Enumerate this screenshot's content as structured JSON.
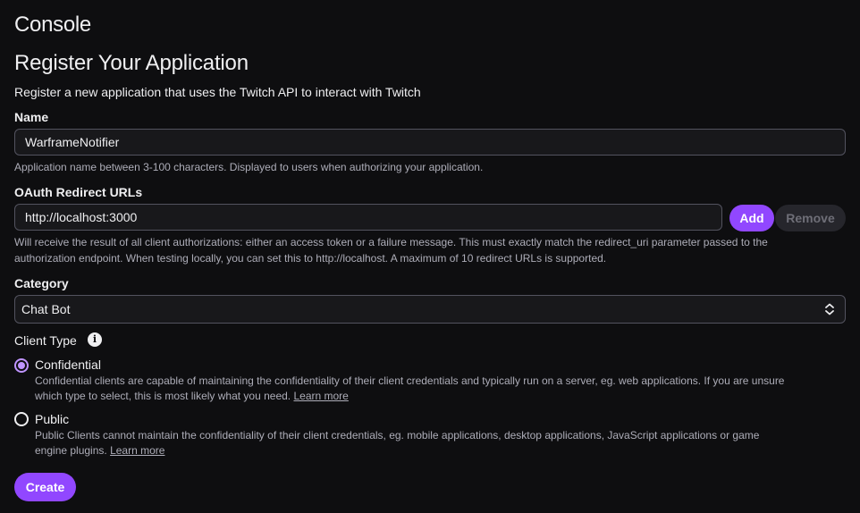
{
  "header": {
    "console_title": "Console",
    "page_title": "Register Your Application",
    "subtitle": "Register a new application that uses the Twitch API to interact with Twitch"
  },
  "form": {
    "name": {
      "label": "Name",
      "value": "WarframeNotifier",
      "help": "Application name between 3-100 characters. Displayed to users when authorizing your application."
    },
    "redirect": {
      "label": "OAuth Redirect URLs",
      "value": "http://localhost:3000",
      "add_label": "Add",
      "remove_label": "Remove",
      "help_line1": "Will receive the result of all client authorizations: either an access token or a failure message. This must exactly match the redirect_uri parameter passed to the",
      "help_line2": "authorization endpoint. When testing locally, you can set this to http://localhost. A maximum of 10 redirect URLs is supported."
    },
    "category": {
      "label": "Category",
      "selected": "Chat Bot"
    },
    "client_type": {
      "label": "Client Type",
      "info_glyph": "i",
      "options": [
        {
          "label": "Confidential",
          "checked": true,
          "desc_line1": "Confidential clients are capable of maintaining the confidentiality of their client credentials and typically run on a server, eg. web applications. If you are unsure",
          "desc_line2": "which type to select, this is most likely what you need.",
          "link": "Learn more"
        },
        {
          "label": "Public",
          "checked": false,
          "desc_line1": "Public Clients cannot maintain the confidentiality of their client credentials, eg. mobile applications, desktop applications, JavaScript applications or game",
          "desc_line2": "engine plugins.",
          "link": "Learn more"
        }
      ]
    },
    "create_label": "Create"
  },
  "colors": {
    "background": "#0e0e10",
    "accent": "#9147ff",
    "radio_accent": "#bf94ff",
    "muted_text": "#adadb8"
  },
  "icons": {
    "info": "info-icon",
    "select_chevron": "chevron-up-down-icon"
  }
}
